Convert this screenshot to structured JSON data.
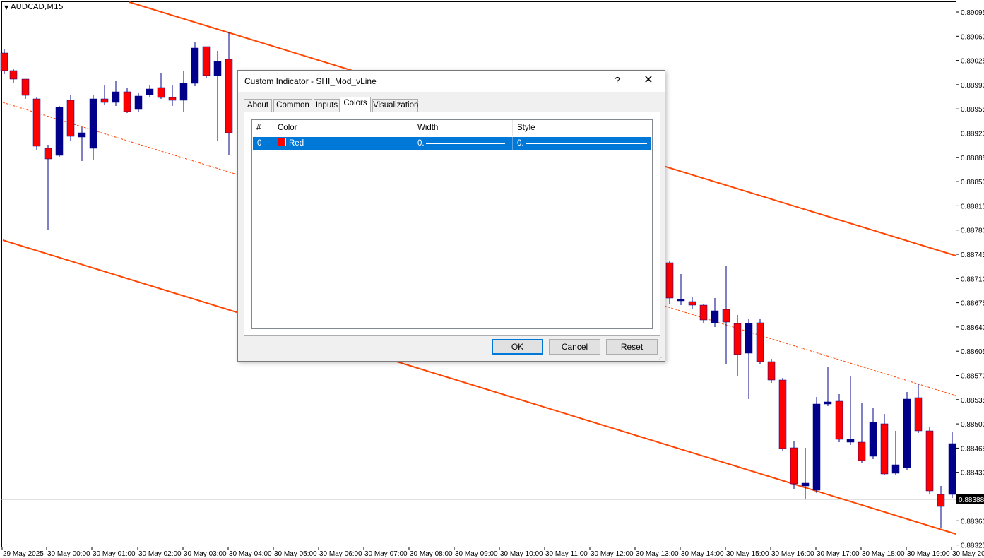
{
  "window": {
    "symbol": "AUDCAD,M15"
  },
  "chart_data": {
    "type": "candlestick",
    "title": "AUDCAD,M15",
    "colors": {
      "bull": "#00008b",
      "bear": "#ff0000",
      "channel": "#ff4500"
    },
    "current_price": "0.88388",
    "y_ticks": [
      "0.89095",
      "0.89060",
      "0.89025",
      "0.88990",
      "0.88955",
      "0.88920",
      "0.88885",
      "0.88850",
      "0.88815",
      "0.88780",
      "0.88745",
      "0.88710",
      "0.88675",
      "0.88640",
      "0.88605",
      "0.88570",
      "0.88535",
      "0.88500",
      "0.88465",
      "0.88430",
      "0.88395",
      "0.88360",
      "0.88325"
    ],
    "x_ticks": [
      "29 May 2025",
      "30 May 00:00",
      "30 May 01:00",
      "30 May 02:00",
      "30 May 03:00",
      "30 May 04:00",
      "30 May 05:00",
      "30 May 06:00",
      "30 May 07:00",
      "30 May 08:00",
      "30 May 09:00",
      "30 May 10:00",
      "30 May 11:00",
      "30 May 12:00",
      "30 May 13:00",
      "30 May 14:00",
      "30 May 15:00",
      "30 May 16:00",
      "30 May 17:00",
      "30 May 18:00",
      "30 May 19:00",
      "30 May 20"
    ],
    "ylim": [
      0.8832,
      0.891
    ]
  },
  "dialog": {
    "title": "Custom Indicator - SHI_Mod_vLine",
    "help_label": "?",
    "close_label": "✕",
    "tabs": [
      "About",
      "Common",
      "Inputs",
      "Colors",
      "Visualization"
    ],
    "active_tab": "Colors",
    "table": {
      "headers": [
        "#",
        "Color",
        "Width",
        "Style"
      ],
      "rows": [
        {
          "index": "0",
          "color": "Red",
          "width": "0.",
          "style": "0."
        }
      ]
    },
    "buttons": {
      "ok": "OK",
      "cancel": "Cancel",
      "reset": "Reset"
    }
  }
}
